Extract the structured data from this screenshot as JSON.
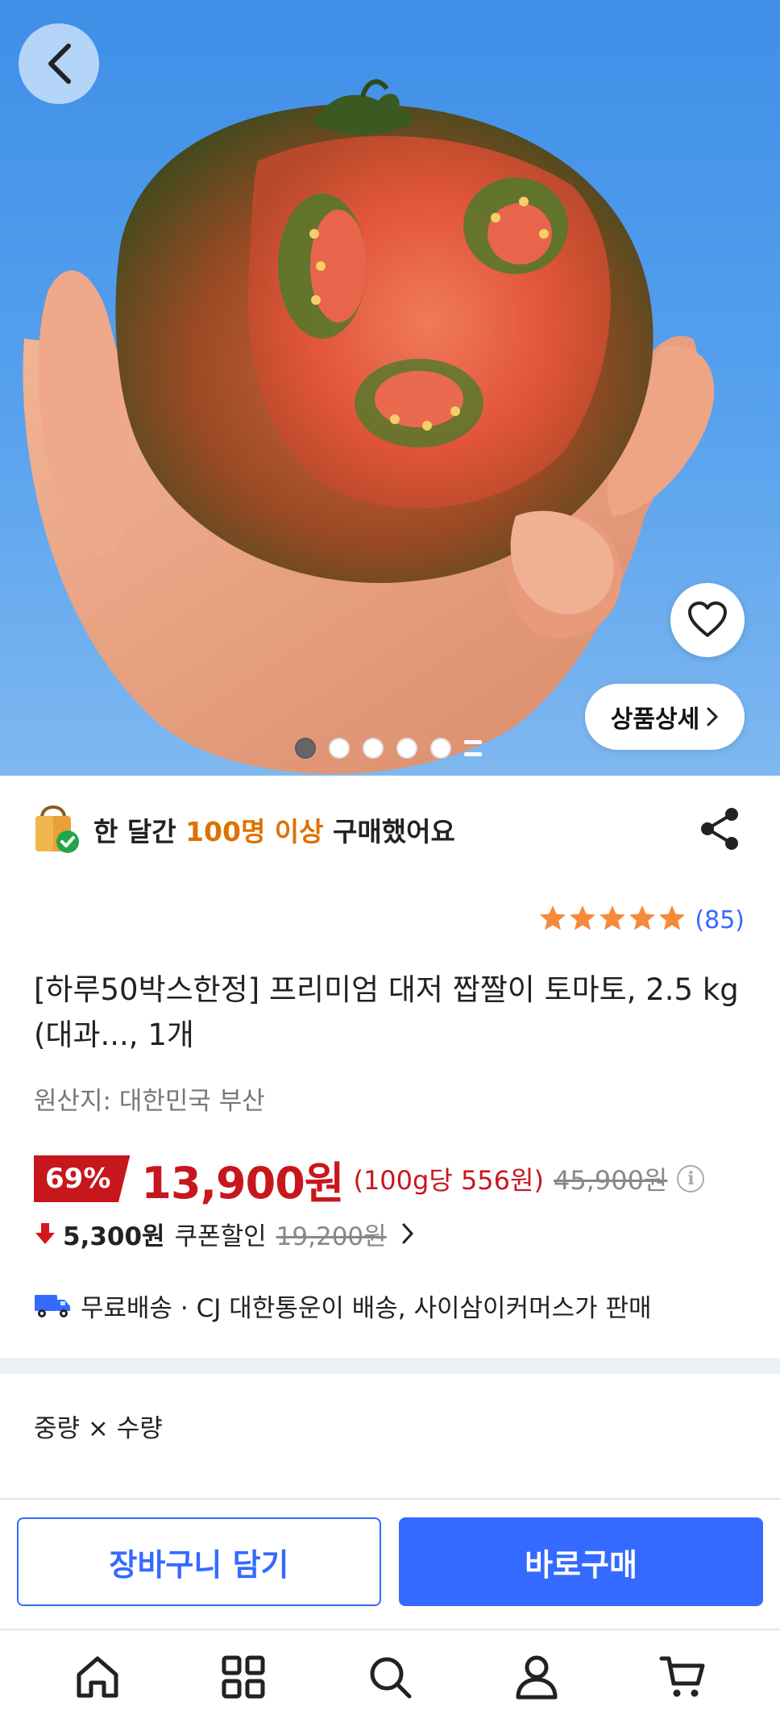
{
  "hero": {
    "detail_label": "상품상세",
    "slide_count": 5,
    "active_slide": 1
  },
  "banner": {
    "prefix": "한 달간 ",
    "highlight": "100명 이상",
    "suffix": " 구매했어요"
  },
  "rating": {
    "stars": 5,
    "count": "(85)"
  },
  "product": {
    "title": "[하루50박스한정] 프리미엄 대저 짭짤이 토마토, 2.5 kg (대과..., 1개",
    "origin": "원산지: 대한민국 부산"
  },
  "price": {
    "discount": "69%",
    "sale": "13,900원",
    "unit": "(100g당 556원)",
    "original": "45,900원"
  },
  "coupon": {
    "amount": "5,300원",
    "label": "쿠폰할인",
    "old_price": "19,200원"
  },
  "shipping": {
    "text": "무료배송 · CJ 대한통운이 배송, 사이삼이커머스가 판매"
  },
  "options": {
    "label": "중량 × 수량"
  },
  "actions": {
    "cart_label": "장바구니 담기",
    "buy_label": "바로구매"
  },
  "colors": {
    "accent": "#346aff",
    "sale": "#c8161d",
    "highlight": "#e07000",
    "star": "#f7893b"
  },
  "nav": {
    "items": [
      "home-icon",
      "category-icon",
      "search-icon",
      "my-page-icon",
      "cart-icon"
    ]
  }
}
